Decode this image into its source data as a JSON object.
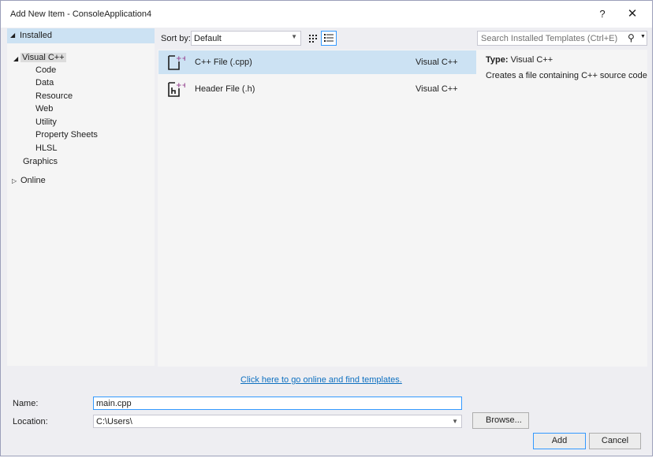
{
  "window": {
    "title": "Add New Item - ConsoleApplication4",
    "help_label": "?",
    "close_label": "✕"
  },
  "left": {
    "installed_label": "Installed",
    "tree": {
      "visual_cpp": "Visual C++",
      "children": [
        "Code",
        "Data",
        "Resource",
        "Web",
        "Utility",
        "Property Sheets",
        "HLSL"
      ],
      "graphics": "Graphics",
      "online": "Online"
    }
  },
  "toolbar": {
    "sort_by_label": "Sort by:",
    "sort_value": "Default",
    "search_placeholder": "Search Installed Templates (Ctrl+E)"
  },
  "templates": [
    {
      "name": "C++ File (.cpp)",
      "lang": "Visual C++",
      "icon": "cpp-file-icon",
      "selected": true
    },
    {
      "name": "Header File (.h)",
      "lang": "Visual C++",
      "icon": "header-file-icon",
      "selected": false
    }
  ],
  "details": {
    "type_label": "Type:",
    "type_value": "Visual C++",
    "description": "Creates a file containing C++ source code"
  },
  "online_link": "Click here to go online and find templates.",
  "form": {
    "name_label": "Name:",
    "name_value": "main.cpp",
    "location_label": "Location:",
    "location_value": "C:\\Users\\",
    "browse_label": "Browse...",
    "add_label": "Add",
    "cancel_label": "Cancel"
  },
  "colors": {
    "selection": "#cce2f3",
    "accent": "#3399ff",
    "link": "#0e70c0",
    "icon_badge": "#9b4f96"
  }
}
